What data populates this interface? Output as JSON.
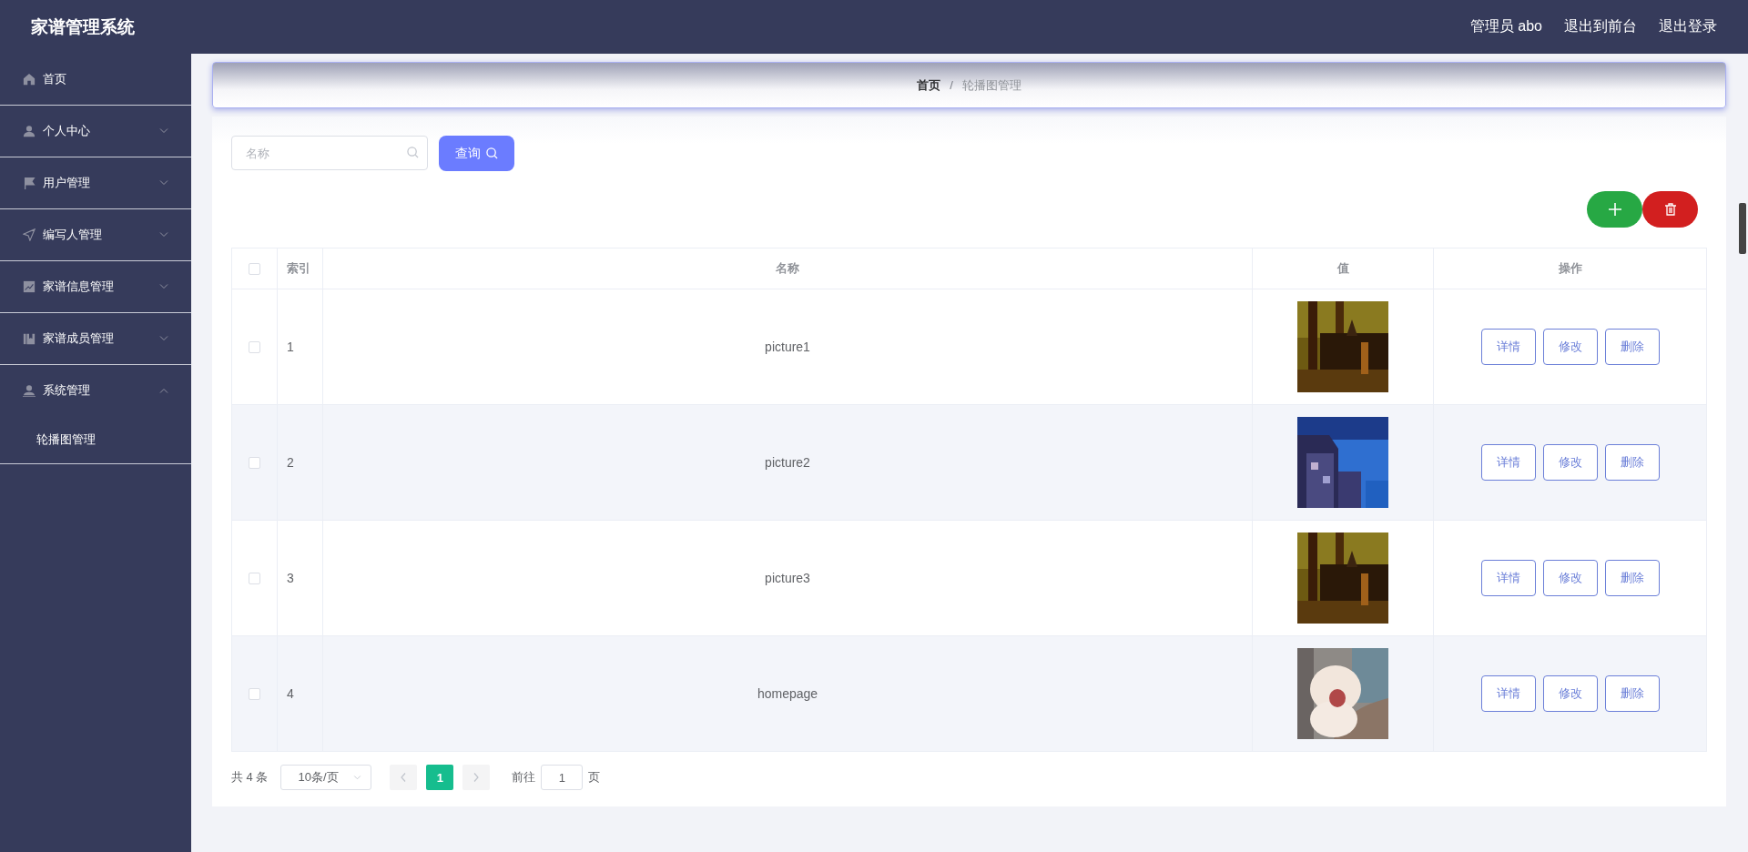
{
  "header": {
    "title": "家谱管理系统",
    "links": [
      "管理员 abo",
      "退出到前台",
      "退出登录"
    ]
  },
  "sidebar": {
    "items": [
      {
        "label": "首页"
      },
      {
        "label": "个人中心",
        "expanded": false
      },
      {
        "label": "用户管理",
        "expanded": false
      },
      {
        "label": "编写人管理",
        "expanded": false
      },
      {
        "label": "家谱信息管理",
        "expanded": false
      },
      {
        "label": "家谱成员管理",
        "expanded": false
      },
      {
        "label": "系统管理",
        "expanded": true,
        "children": [
          {
            "label": "轮播图管理"
          }
        ]
      }
    ]
  },
  "breadcrumb": {
    "items": [
      "首页",
      "轮播图管理"
    ],
    "separator": "/"
  },
  "search": {
    "placeholder": "名称",
    "button": "查询"
  },
  "table": {
    "columns": [
      "索引",
      "名称",
      "值",
      "操作"
    ],
    "header_checked": false,
    "rows": [
      {
        "checked": false,
        "index": "1",
        "name": "picture1",
        "value": {
          "kind": "picture"
        },
        "actions": [
          "详情",
          "修改",
          "删除"
        ]
      },
      {
        "checked": false,
        "index": "2",
        "name": "picture2",
        "value": {
          "kind": "picture"
        },
        "actions": [
          "详情",
          "修改",
          "删除"
        ]
      },
      {
        "checked": false,
        "index": "3",
        "name": "picture3",
        "value": {
          "kind": "picture"
        },
        "actions": [
          "详情",
          "修改",
          "删除"
        ]
      },
      {
        "checked": false,
        "index": "4",
        "name": "homepage",
        "value": {
          "kind": "picture"
        },
        "actions": [
          "详情",
          "修改",
          "删除"
        ]
      }
    ]
  },
  "pagination": {
    "total": "共 4 条",
    "page_size": "10条/页",
    "pages": [
      {
        "label": "1",
        "selected": true
      }
    ],
    "goto_label": "前往",
    "goto_value": "1",
    "goto_suffix": "页"
  }
}
